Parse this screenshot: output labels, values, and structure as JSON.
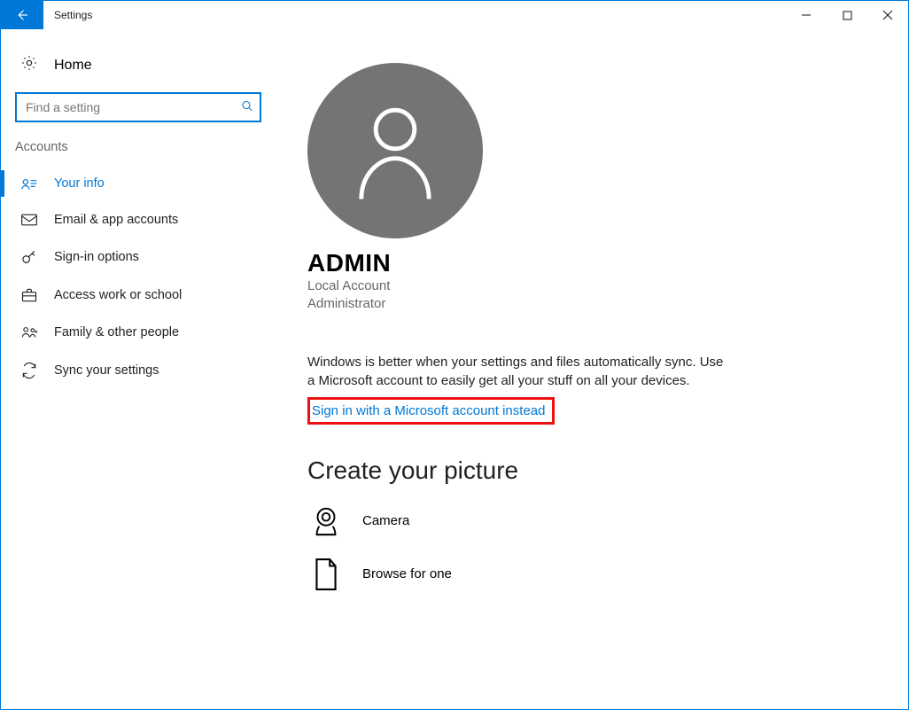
{
  "window": {
    "title": "Settings"
  },
  "sidebar": {
    "home": "Home",
    "search_placeholder": "Find a setting",
    "section": "Accounts",
    "items": [
      {
        "label": "Your info"
      },
      {
        "label": "Email & app accounts"
      },
      {
        "label": "Sign-in options"
      },
      {
        "label": "Access work or school"
      },
      {
        "label": "Family & other people"
      },
      {
        "label": "Sync your settings"
      }
    ]
  },
  "main": {
    "user_name": "ADMIN",
    "account_type": "Local Account",
    "role": "Administrator",
    "sync_text": "Windows is better when your settings and files automatically sync. Use a Microsoft account to easily get all your stuff on all your devices.",
    "signin_link": "Sign in with a Microsoft account instead",
    "picture_heading": "Create your picture",
    "camera_label": "Camera",
    "browse_label": "Browse for one"
  }
}
